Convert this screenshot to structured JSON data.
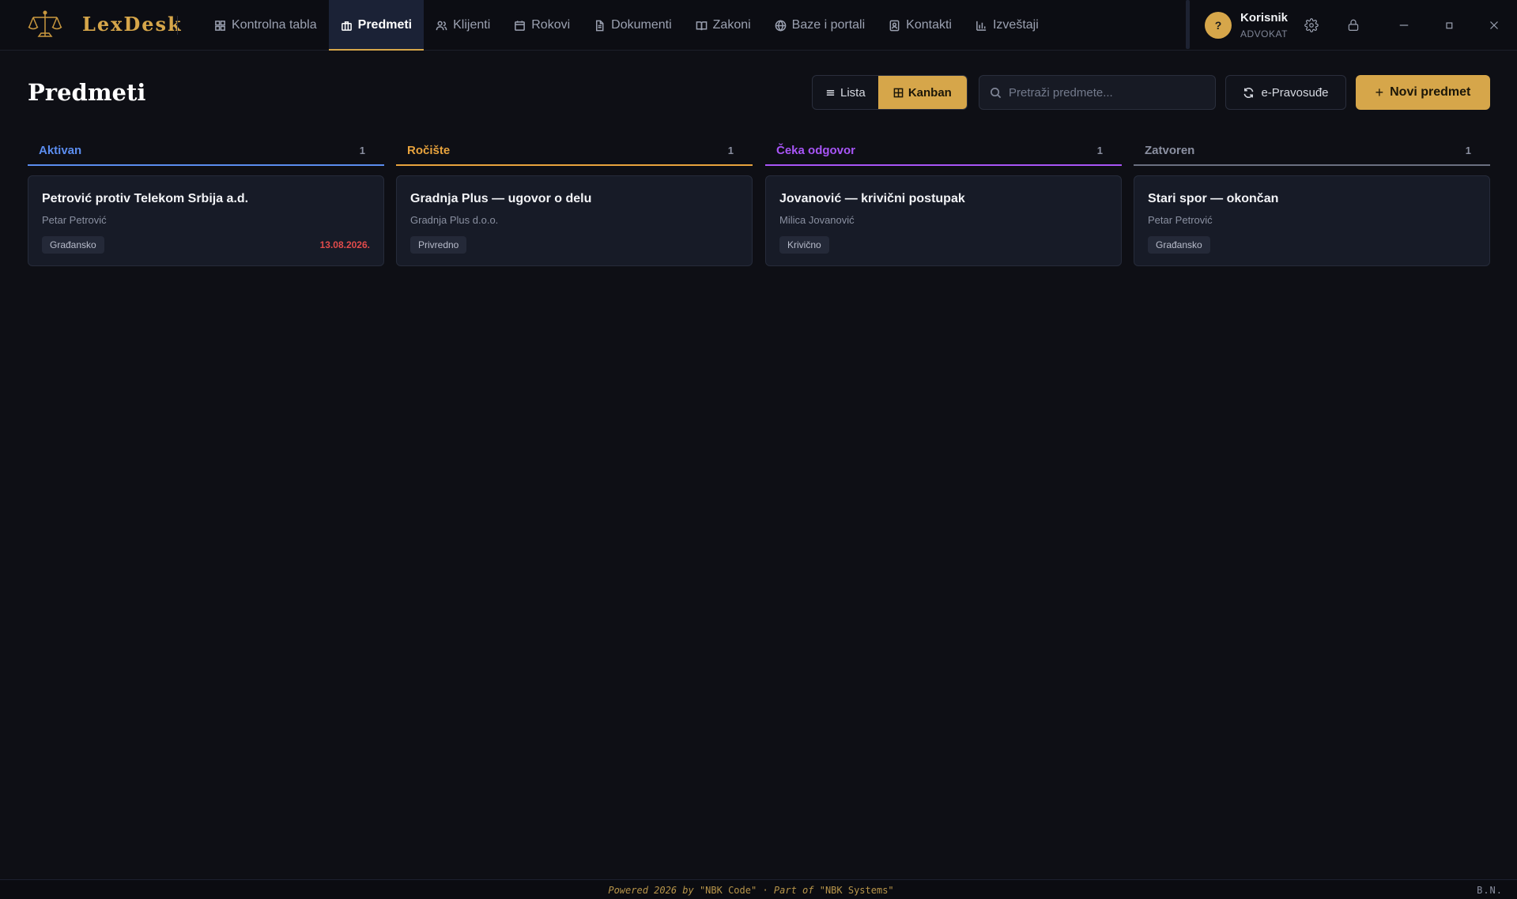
{
  "app": {
    "brand": "LexDesk",
    "accent_color": "#d6a64a"
  },
  "nav": {
    "items": [
      {
        "label": "Kontrolna tabla",
        "icon": "dashboard-icon"
      },
      {
        "label": "Predmeti",
        "icon": "briefcase-icon",
        "active": true
      },
      {
        "label": "Klijenti",
        "icon": "users-icon"
      },
      {
        "label": "Rokovi",
        "icon": "calendar-icon"
      },
      {
        "label": "Dokumenti",
        "icon": "document-icon"
      },
      {
        "label": "Zakoni",
        "icon": "book-icon"
      },
      {
        "label": "Baze i portali",
        "icon": "globe-icon"
      },
      {
        "label": "Kontakti",
        "icon": "contact-icon"
      },
      {
        "label": "Izveštaji",
        "icon": "bar-chart-icon"
      }
    ]
  },
  "user": {
    "avatar_initial": "?",
    "name": "Korisnik",
    "role": "ADVOKAT"
  },
  "page": {
    "title": "Predmeti"
  },
  "toolbar": {
    "view_lista": "Lista",
    "view_kanban": "Kanban",
    "active_view": "Kanban",
    "search_placeholder": "Pretraži predmete...",
    "epravosudje_label": "e-Pravosuđe",
    "new_case_label": "Novi predmet",
    "new_case_plus": "+"
  },
  "columns": [
    {
      "title": "Aktivan",
      "count": "1",
      "color": "#5b8def",
      "cards": [
        {
          "title": "Petrović protiv Telekom Srbija a.d.",
          "client": "Petar Petrović",
          "tag": "Građansko",
          "date": "13.08.2026."
        }
      ]
    },
    {
      "title": "Ročište",
      "count": "1",
      "color": "#e8a33d",
      "cards": [
        {
          "title": "Gradnja Plus — ugovor o delu",
          "client": "Gradnja Plus d.o.o.",
          "tag": "Privredno",
          "date": ""
        }
      ]
    },
    {
      "title": "Čeka odgovor",
      "count": "1",
      "color": "#a855f7",
      "cards": [
        {
          "title": "Jovanović — krivični postupak",
          "client": "Milica Jovanović",
          "tag": "Krivično",
          "date": ""
        }
      ]
    },
    {
      "title": "Zatvoren",
      "count": "1",
      "color": "#6b7080",
      "cards": [
        {
          "title": "Stari spor — okončan",
          "client": "Petar Petrović",
          "tag": "Građansko",
          "date": ""
        }
      ]
    }
  ],
  "footer": {
    "powered": "Powered 2026 by",
    "company": "\"NBK Code\"",
    "dot": "·",
    "part_of": "Part of",
    "parent": "\"NBK Systems\"",
    "initials": "B.N."
  }
}
